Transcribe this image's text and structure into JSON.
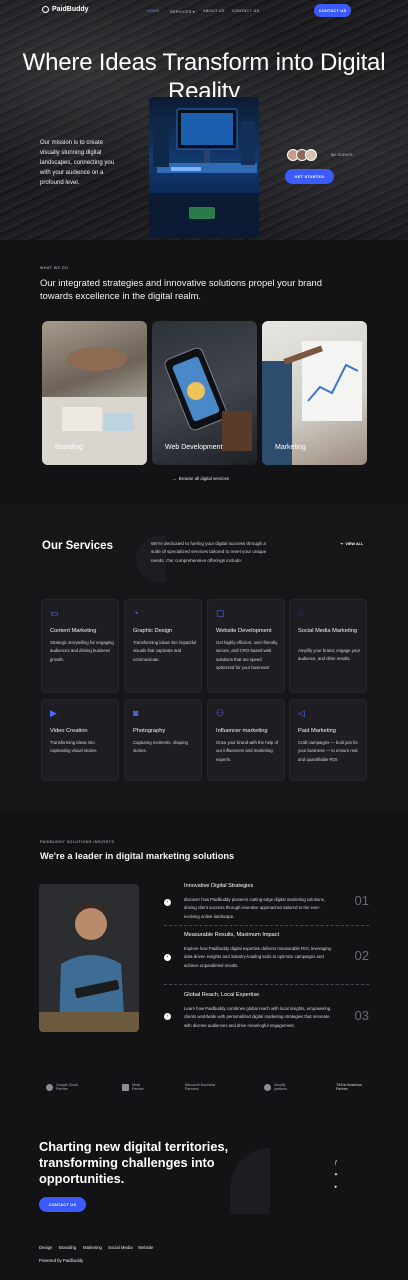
{
  "nav": {
    "logo": "PaidBuddy",
    "links": [
      "HOME",
      "SERVICES",
      "ABOUT US",
      "CONTACT US"
    ],
    "cta": "CONTACT US"
  },
  "hero": {
    "title": "Where Ideas Transform into Digital Reality",
    "text": "Our mission is to create visually stunning digital landscapes, connecting you with your audience on a profound level.",
    "clients": "5k+ CLIENTS",
    "cta": "GET STARTED"
  },
  "what_we_do": {
    "eyebrow": "WHAT WE DO",
    "lead": "Our integrated strategies and innovative solutions propel your brand towards excellence in the digital realm.",
    "cards": [
      "Branding",
      "Web Development",
      "Marketing"
    ],
    "browse": "Browse all digital services"
  },
  "services": {
    "title": "Our Services",
    "desc": "We're dedicated to fueling your digital success through a suite of specialized services tailored to meet your unique needs. Our comprehensive offerings include:",
    "view_all": "VIEW ALL",
    "items": [
      {
        "title": "Content Marketing",
        "desc": "Strategic storytelling for engaging audiences and driving business growth.",
        "icon": "monitor-icon"
      },
      {
        "title": "Graphic Design",
        "desc": "Transforming ideas into impactful visuals that captivate and communicate.",
        "icon": "pie-chart-icon"
      },
      {
        "title": "Website Development",
        "desc": "Get highly efficient, user-friendly, secure, and CRO-based web solutions that are speed optimized for your business!",
        "icon": "desktop-icon"
      },
      {
        "title": "Social Media Marketing",
        "desc": "Amplify your brand, engage your audience, and drive results.",
        "icon": "chat-bubble-icon"
      },
      {
        "title": "Video Creation",
        "desc": "Transforming ideas into captivating visual stories",
        "icon": "video-icon"
      },
      {
        "title": "Photography",
        "desc": "Capturing moments, shaping stories.",
        "icon": "camera-icon"
      },
      {
        "title": "Influencer marketing",
        "desc": "Grow your brand with the help of our influencers and marketing experts.",
        "icon": "users-icon"
      },
      {
        "title": "Paid Marketing",
        "desc": "Craft campaigns — built just for your business — to ensure real and quantifiable ROI.",
        "icon": "megaphone-icon"
      }
    ]
  },
  "leader": {
    "eyebrow": "PAIDBUDDY SOLUTIONS INSIGHTS",
    "title": "We're a leader in digital marketing solutions",
    "features": [
      {
        "title": "Innovative Digital Strategies",
        "desc": "discover how Paidbuddy pioneers cutting-edge digital marketing solutions, driving client success through inventive approaches tailored to the ever-evolving online landscape.",
        "num": "01"
      },
      {
        "title": "Measurable Results, Maximum Impact",
        "desc": "Explore how Paidbuddy digital expertise delivers measurable ROI, leveraging data-driven insights and industry-leading tools to optimize campaigns and achieve unparalleled results.",
        "num": "02"
      },
      {
        "title": "Global Reach, Local Expertise",
        "desc": "Learn how Paidbuddy combines global reach with local insights, empowering clients worldwide with personalized digital marketing strategies that resonate with diverse audiences and drive meaningful engagement.",
        "num": "03"
      }
    ]
  },
  "partners": [
    "Google Cloud Partner",
    "Meta Partner",
    "Microsoft Business Partners",
    "shopify partners",
    "TikTok Business Partner"
  ],
  "footer": {
    "cta_title": "Charting new digital territories, transforming challenges into opportunities.",
    "cta": "CONTACT US",
    "links": [
      "Design",
      "Branding",
      "Marketing",
      "Social Media",
      "Website"
    ],
    "powered": "Powered by Paidbuddy"
  }
}
